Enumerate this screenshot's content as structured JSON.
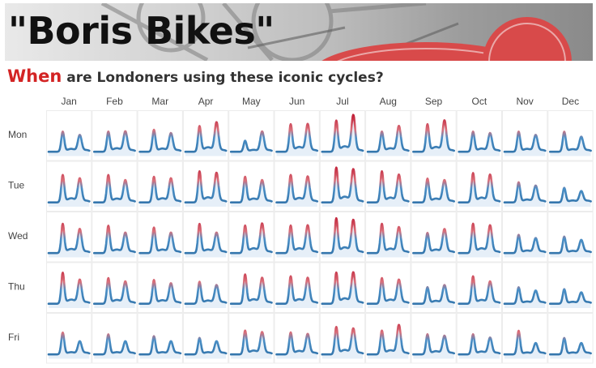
{
  "header": {
    "title": "\"Boris Bikes\"",
    "subtitle_lead": "When",
    "subtitle_rest": " are Londoners using these iconic cycles?"
  },
  "colors": {
    "peak": "#c2233a",
    "base": "#2e6fa6",
    "fill": "#dce8f5",
    "cell_border": "#ececec",
    "accent": "#d32424",
    "wheel": "#d84a4a"
  },
  "chart_data": {
    "type": "line",
    "title": "",
    "xlabel": "",
    "ylabel": "",
    "grid": true,
    "legend": "none",
    "description_of_encoding": "small-multiples of hourly usage (0-23h) per weekday (rows) and month (columns); line colored from blue (low) to red (high)",
    "months": [
      "Jan",
      "Feb",
      "Mar",
      "Apr",
      "May",
      "Jun",
      "Jul",
      "Aug",
      "Sep",
      "Oct",
      "Nov",
      "Dec"
    ],
    "days": [
      "Mon",
      "Tue",
      "Wed",
      "Thu",
      "Fri"
    ],
    "hours": [
      0,
      1,
      2,
      3,
      4,
      5,
      6,
      7,
      8,
      9,
      10,
      11,
      12,
      13,
      14,
      15,
      16,
      17,
      18,
      19,
      20,
      21,
      22,
      23
    ],
    "ylim": [
      0,
      1
    ],
    "peaks": {
      "Mon": [
        [
          0.55,
          0.45
        ],
        [
          0.55,
          0.55
        ],
        [
          0.6,
          0.5
        ],
        [
          0.7,
          0.8
        ],
        [
          0.3,
          0.55
        ],
        [
          0.75,
          0.75
        ],
        [
          0.85,
          1.0
        ],
        [
          0.55,
          0.7
        ],
        [
          0.75,
          0.85
        ],
        [
          0.55,
          0.5
        ],
        [
          0.55,
          0.45
        ],
        [
          0.55,
          0.4
        ]
      ],
      "Tue": [
        [
          0.75,
          0.65
        ],
        [
          0.75,
          0.6
        ],
        [
          0.7,
          0.65
        ],
        [
          0.85,
          0.8
        ],
        [
          0.7,
          0.6
        ],
        [
          0.75,
          0.7
        ],
        [
          0.95,
          0.9
        ],
        [
          0.85,
          0.75
        ],
        [
          0.65,
          0.6
        ],
        [
          0.8,
          0.75
        ],
        [
          0.55,
          0.45
        ],
        [
          0.4,
          0.3
        ]
      ],
      "Wed": [
        [
          0.8,
          0.65
        ],
        [
          0.75,
          0.55
        ],
        [
          0.7,
          0.55
        ],
        [
          0.8,
          0.55
        ],
        [
          0.75,
          0.8
        ],
        [
          0.75,
          0.75
        ],
        [
          0.95,
          0.9
        ],
        [
          0.8,
          0.7
        ],
        [
          0.55,
          0.65
        ],
        [
          0.8,
          0.75
        ],
        [
          0.5,
          0.4
        ],
        [
          0.45,
          0.35
        ]
      ],
      "Thu": [
        [
          0.85,
          0.65
        ],
        [
          0.7,
          0.6
        ],
        [
          0.65,
          0.55
        ],
        [
          0.6,
          0.5
        ],
        [
          0.8,
          0.7
        ],
        [
          0.75,
          0.7
        ],
        [
          0.85,
          0.85
        ],
        [
          0.7,
          0.65
        ],
        [
          0.45,
          0.5
        ],
        [
          0.75,
          0.6
        ],
        [
          0.45,
          0.35
        ],
        [
          0.4,
          0.3
        ]
      ],
      "Fri": [
        [
          0.6,
          0.35
        ],
        [
          0.55,
          0.35
        ],
        [
          0.5,
          0.35
        ],
        [
          0.45,
          0.35
        ],
        [
          0.65,
          0.6
        ],
        [
          0.6,
          0.55
        ],
        [
          0.75,
          0.7
        ],
        [
          0.65,
          0.8
        ],
        [
          0.55,
          0.5
        ],
        [
          0.55,
          0.45
        ],
        [
          0.65,
          0.3
        ],
        [
          0.45,
          0.3
        ]
      ]
    }
  }
}
